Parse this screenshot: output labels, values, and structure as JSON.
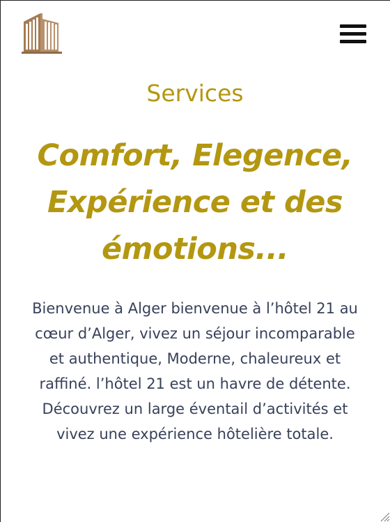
{
  "header": {
    "logo_icon": "hotel-building-logo",
    "menu_icon": "hamburger-menu-icon"
  },
  "services": {
    "section_title": "Services",
    "headline_lines": [
      "Comfort, Elegence,",
      "Expérience et des",
      "émotions..."
    ],
    "intro_lines": [
      "Bienvenue à Alger bienvenue à l’hôtel 21 au",
      "cœur d’Alger, vivez un séjour incomparable",
      "et authentique, Moderne, chaleureux et",
      "raffiné. l’hôtel 21 est un havre de détente.",
      "Découvrez un large éventail d’activités et",
      "vivez une expérience hôtelière totale."
    ]
  },
  "colors": {
    "accent_gold": "#b39710",
    "body_text": "#38415a",
    "logo_brown": "#9a7450"
  }
}
